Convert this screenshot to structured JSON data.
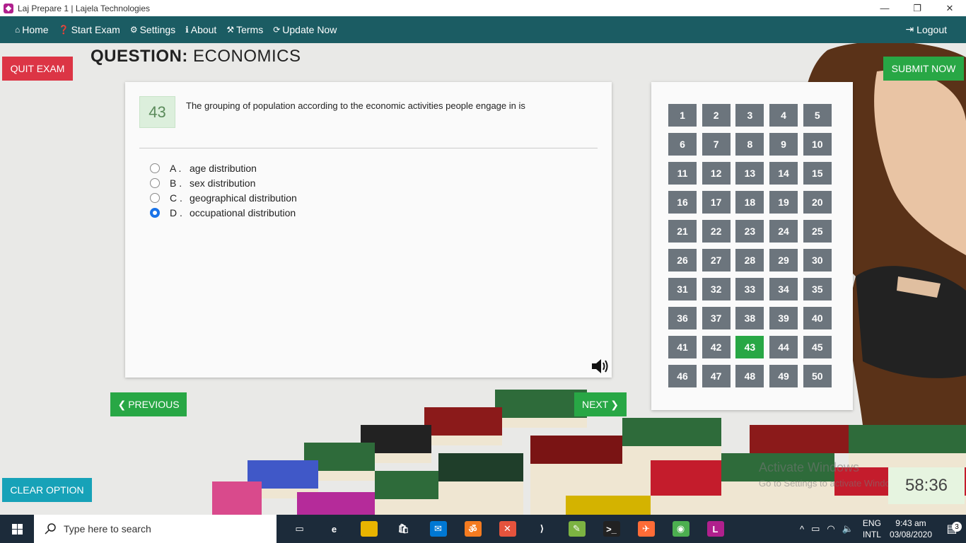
{
  "window": {
    "title": "Laj Prepare 1 | Lajela Technologies",
    "controls": [
      "minimize",
      "restore",
      "close"
    ]
  },
  "nav": {
    "items": [
      {
        "icon": "home-icon",
        "label": "Home"
      },
      {
        "icon": "question-circle-icon",
        "label": "Start Exam"
      },
      {
        "icon": "gear-icon",
        "label": "Settings"
      },
      {
        "icon": "info-icon",
        "label": "About"
      },
      {
        "icon": "gavel-icon",
        "label": "Terms"
      },
      {
        "icon": "refresh-icon",
        "label": "Update Now"
      }
    ],
    "logout_label": "Logout"
  },
  "exam": {
    "quit_label": "QUIT EXAM",
    "heading_prefix": "QUESTION:",
    "subject": "ECONOMICS",
    "submit_label": "SUBMIT NOW",
    "question_number": "43",
    "question_text": "The grouping of population according to the economic activities people engage in is",
    "options": [
      {
        "letter": "A .",
        "text": "age distribution",
        "selected": false
      },
      {
        "letter": "B .",
        "text": "sex distribution",
        "selected": false
      },
      {
        "letter": "C .",
        "text": "geographical distribution",
        "selected": false
      },
      {
        "letter": "D .",
        "text": "occupational distribution",
        "selected": true
      }
    ],
    "previous_label": "PREVIOUS",
    "next_label": "NEXT",
    "clear_label": "CLEAR OPTION",
    "timer": "58:36",
    "current_question": 43,
    "question_buttons": [
      "1",
      "2",
      "3",
      "4",
      "5",
      "6",
      "7",
      "8",
      "9",
      "10",
      "11",
      "12",
      "13",
      "14",
      "15",
      "16",
      "17",
      "18",
      "19",
      "20",
      "21",
      "22",
      "23",
      "24",
      "25",
      "26",
      "27",
      "28",
      "29",
      "30",
      "31",
      "32",
      "33",
      "34",
      "35",
      "36",
      "37",
      "38",
      "39",
      "40",
      "41",
      "42",
      "43",
      "44",
      "45",
      "46",
      "47",
      "48",
      "49",
      "50"
    ]
  },
  "watermark": {
    "line1": "Activate Windows",
    "line2": "Go to Settings to activate Windows."
  },
  "taskbar": {
    "search_placeholder": "Type here to search",
    "lang_line1": "ENG",
    "lang_line2": "INTL",
    "time": "9:43 am",
    "date": "03/08/2020",
    "notification_count": "3",
    "apps": [
      {
        "name": "task-view-icon",
        "color": "#1c2b3a",
        "glyph": "▭"
      },
      {
        "name": "edge-icon",
        "color": "#1c2b3a",
        "glyph": "e"
      },
      {
        "name": "file-explorer-icon",
        "color": "#e8b400",
        "glyph": ""
      },
      {
        "name": "store-icon",
        "color": "#1c2b3a",
        "glyph": "🛍"
      },
      {
        "name": "mail-icon",
        "color": "#0078d4",
        "glyph": "✉"
      },
      {
        "name": "xampp-icon",
        "color": "#f47b20",
        "glyph": "ॐ"
      },
      {
        "name": "autodesk-icon",
        "color": "#e5533d",
        "glyph": "✕"
      },
      {
        "name": "vscode-icon",
        "color": "#1c2b3a",
        "glyph": "⟩"
      },
      {
        "name": "notepad-plus-icon",
        "color": "#7cb342",
        "glyph": "✎"
      },
      {
        "name": "terminal-icon",
        "color": "#222",
        "glyph": ">_"
      },
      {
        "name": "postman-icon",
        "color": "#ff6c37",
        "glyph": "✈"
      },
      {
        "name": "chrome-icon",
        "color": "#4caf50",
        "glyph": "◉"
      },
      {
        "name": "laj-prepare-icon",
        "color": "#b0208d",
        "glyph": "L"
      }
    ]
  }
}
